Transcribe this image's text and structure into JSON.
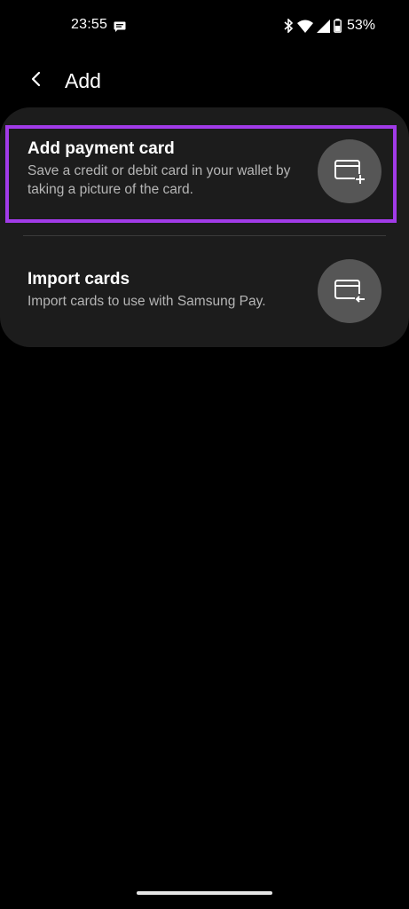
{
  "status_bar": {
    "time": "23:55",
    "battery_percent": "53%",
    "notification_icon": "message-icon",
    "icons": [
      "bluetooth-icon",
      "wifi-icon",
      "signal-icon",
      "battery-icon"
    ]
  },
  "header": {
    "back_icon": "chevron-left-icon",
    "title": "Add"
  },
  "options": [
    {
      "title": "Add payment card",
      "description": "Save a credit or debit card in your wallet by taking a picture of the card.",
      "icon": "card-add-icon",
      "highlighted": true
    },
    {
      "title": "Import cards",
      "description": "Import cards to use with Samsung Pay.",
      "icon": "card-import-icon",
      "highlighted": false
    }
  ],
  "colors": {
    "background": "#000000",
    "panel": "#1c1c1c",
    "icon_circle": "#565656",
    "highlight": "#a13be8",
    "secondary_text": "#b5b5b5"
  }
}
